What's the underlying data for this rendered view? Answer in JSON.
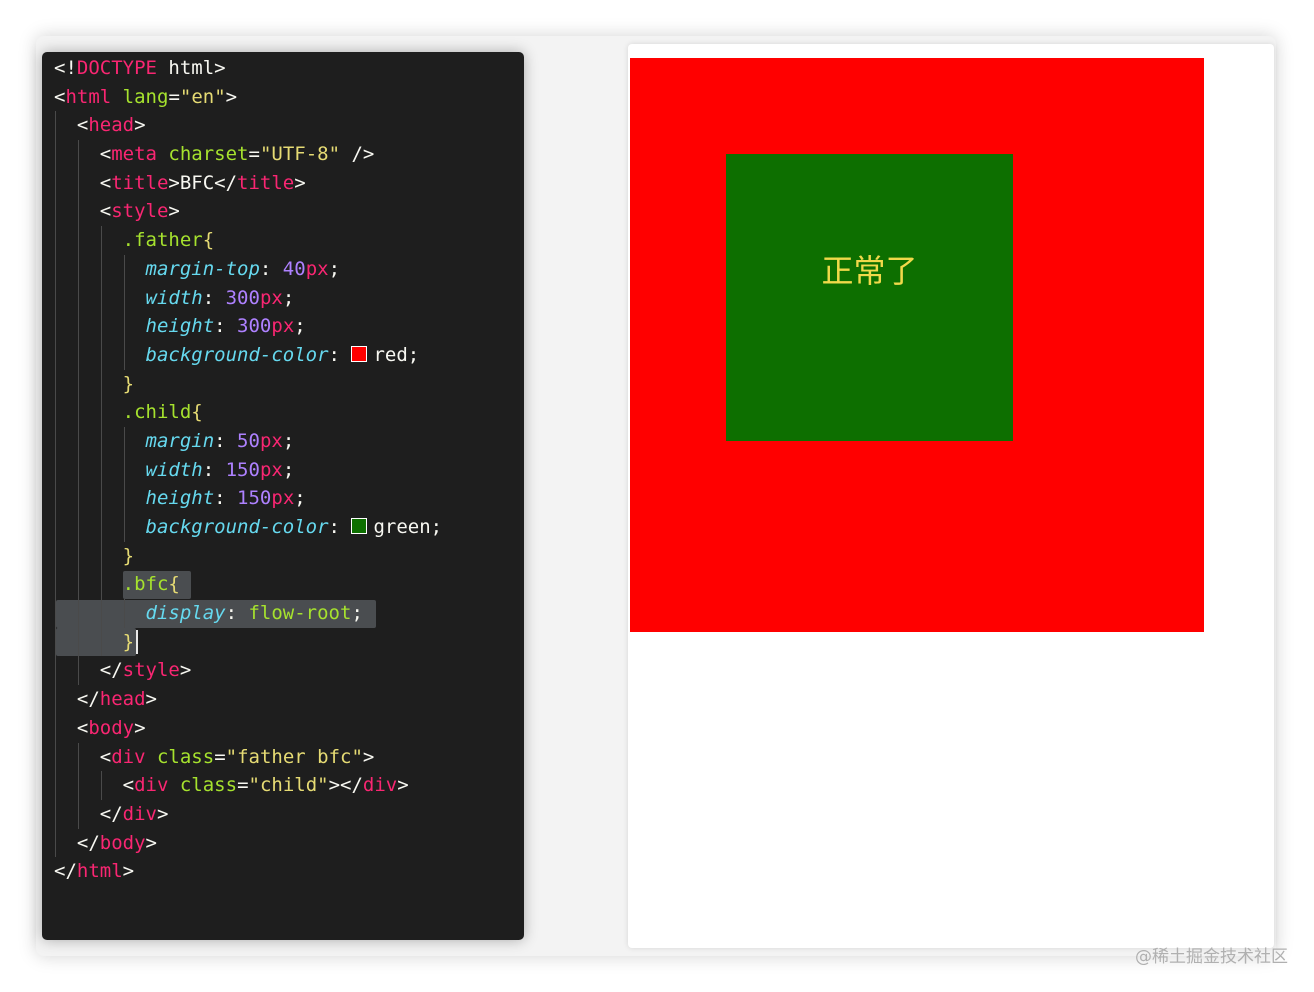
{
  "editor": {
    "lines": [
      {
        "id": 0,
        "t": [
          "<!",
          [
            "DOCTYPE",
            "tag"
          ],
          " html>"
        ]
      },
      {
        "id": 1,
        "t": [
          "<",
          [
            "html",
            "tag"
          ],
          " ",
          [
            "lang",
            "attr"
          ],
          "=",
          [
            "\"en\"",
            "str"
          ],
          ">"
        ]
      },
      {
        "id": 2,
        "t": [
          "  <",
          [
            "head",
            "tag"
          ],
          ">"
        ]
      },
      {
        "id": 3,
        "t": [
          "    <",
          [
            "meta",
            "tag"
          ],
          " ",
          [
            "charset",
            "attr"
          ],
          "=",
          [
            "\"UTF-8\"",
            "str"
          ],
          " />"
        ]
      },
      {
        "id": 4,
        "t": [
          "    <",
          [
            "title",
            "tag"
          ],
          ">BFC</",
          [
            "title",
            "tag"
          ],
          ">"
        ]
      },
      {
        "id": 5,
        "t": [
          "    <",
          [
            "style",
            "tag"
          ],
          ">"
        ]
      },
      {
        "id": 6,
        "t": [
          "      ",
          [
            ".father",
            "sel"
          ],
          [
            "{",
            "brace"
          ]
        ]
      },
      {
        "id": 7,
        "t": [
          "        ",
          [
            "margin-top",
            "prop"
          ],
          ": ",
          [
            "40",
            "num"
          ],
          [
            "px",
            "unit"
          ],
          ";"
        ]
      },
      {
        "id": 8,
        "t": [
          "        ",
          [
            "width",
            "prop"
          ],
          ": ",
          [
            "300",
            "num"
          ],
          [
            "px",
            "unit"
          ],
          ";"
        ]
      },
      {
        "id": 9,
        "t": [
          "        ",
          [
            "height",
            "prop"
          ],
          ": ",
          [
            "300",
            "num"
          ],
          [
            "px",
            "unit"
          ],
          ";"
        ]
      },
      {
        "id": 10,
        "t": [
          "        ",
          [
            "background-color",
            "prop"
          ],
          ": ",
          [
            "#ff0000",
            "swatch"
          ],
          [
            "red",
            "txt"
          ],
          ";"
        ]
      },
      {
        "id": 11,
        "t": [
          "      ",
          [
            "}",
            "brace"
          ]
        ]
      },
      {
        "id": 12,
        "t": [
          "      ",
          [
            ".child",
            "sel"
          ],
          [
            "{",
            "brace"
          ]
        ]
      },
      {
        "id": 13,
        "t": [
          "        ",
          [
            "margin",
            "prop"
          ],
          ": ",
          [
            "50",
            "num"
          ],
          [
            "px",
            "unit"
          ],
          ";"
        ]
      },
      {
        "id": 14,
        "t": [
          "        ",
          [
            "width",
            "prop"
          ],
          ": ",
          [
            "150",
            "num"
          ],
          [
            "px",
            "unit"
          ],
          ";"
        ]
      },
      {
        "id": 15,
        "t": [
          "        ",
          [
            "height",
            "prop"
          ],
          ": ",
          [
            "150",
            "num"
          ],
          [
            "px",
            "unit"
          ],
          ";"
        ]
      },
      {
        "id": 16,
        "t": [
          "        ",
          [
            "background-color",
            "prop"
          ],
          ": ",
          [
            "#0d6f00",
            "swatch"
          ],
          [
            "green",
            "txt"
          ],
          ";"
        ]
      },
      {
        "id": 17,
        "t": [
          "      ",
          [
            "}",
            "brace"
          ]
        ]
      },
      {
        "id": 18,
        "t": [
          "      ",
          [
            ".bfc",
            "sel"
          ],
          [
            "{",
            "brace"
          ]
        ]
      },
      {
        "id": 19,
        "t": [
          "        ",
          [
            "display",
            "prop"
          ],
          ": ",
          [
            "flow-root",
            "attr"
          ],
          ";"
        ]
      },
      {
        "id": 20,
        "t": [
          "      ",
          [
            "}",
            "brace"
          ]
        ]
      },
      {
        "id": 21,
        "t": [
          "    </",
          [
            "style",
            "tag"
          ],
          ">"
        ]
      },
      {
        "id": 22,
        "t": [
          "  </",
          [
            "head",
            "tag"
          ],
          ">"
        ]
      },
      {
        "id": 23,
        "t": [
          "  <",
          [
            "body",
            "tag"
          ],
          ">"
        ]
      },
      {
        "id": 24,
        "t": [
          "    <",
          [
            "div",
            "tag"
          ],
          " ",
          [
            "class",
            "attr"
          ],
          "=",
          [
            "\"father bfc\"",
            "str"
          ],
          ">"
        ]
      },
      {
        "id": 25,
        "t": [
          "      <",
          [
            "div",
            "tag"
          ],
          " ",
          [
            "class",
            "attr"
          ],
          "=",
          [
            "\"child\"",
            "str"
          ],
          "></",
          [
            "div",
            "tag"
          ],
          ">"
        ]
      },
      {
        "id": 26,
        "t": [
          "    </",
          [
            "div",
            "tag"
          ],
          ">"
        ]
      },
      {
        "id": 27,
        "t": [
          "  </",
          [
            "body",
            "tag"
          ],
          ">"
        ]
      },
      {
        "id": 28,
        "t": [
          "</",
          [
            "html",
            "tag"
          ],
          ">"
        ]
      }
    ]
  },
  "preview": {
    "father_color": "#ff0000",
    "child_color": "#0d6f00",
    "child_text": "正常了"
  },
  "watermark": "@稀土掘金技术社区"
}
